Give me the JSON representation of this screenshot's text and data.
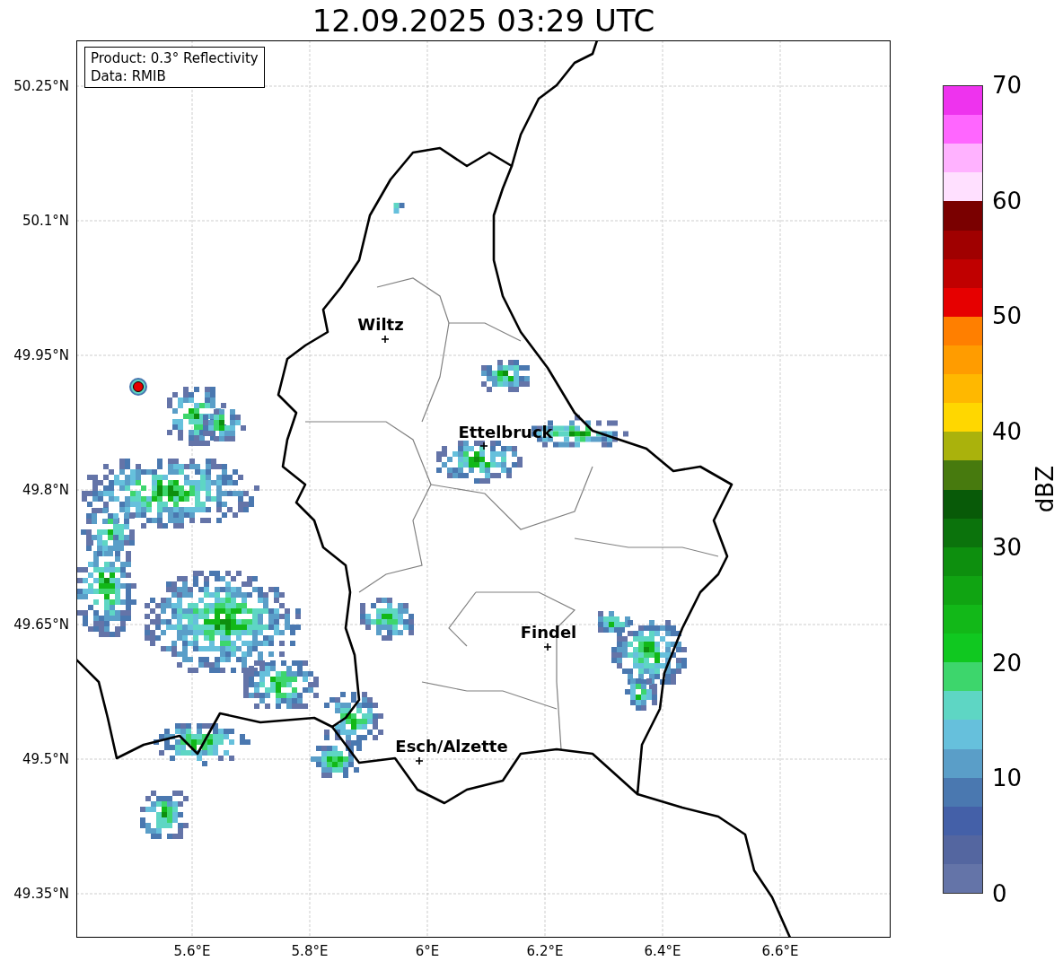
{
  "title": "12.09.2025 03:29 UTC",
  "info_box": [
    "Product: 0.3° Reflectivity",
    "Data: RMIB"
  ],
  "lat_labels": [
    "50.25°N",
    "50.1°N",
    "49.95°N",
    "49.8°N",
    "49.65°N",
    "49.5°N",
    "49.35°N"
  ],
  "lon_labels": [
    "5.6°E",
    "5.8°E",
    "6°E",
    "6.2°E",
    "6.4°E",
    "6.6°E"
  ],
  "cities": [
    {
      "label": "Wiltz"
    },
    {
      "label": "Ettelbruck"
    },
    {
      "label": "Findel"
    },
    {
      "label": "Esch/Alzette"
    }
  ],
  "colorbar": {
    "label": "dBZ",
    "ticks": [
      "70",
      "60",
      "50",
      "40",
      "30",
      "20",
      "10",
      "0"
    ],
    "bins": [
      {
        "color": "#ee33ee"
      },
      {
        "color": "#ff66ff"
      },
      {
        "color": "#ffb2ff"
      },
      {
        "color": "#ffe0ff"
      },
      {
        "color": "#7a0000"
      },
      {
        "color": "#a00000"
      },
      {
        "color": "#c00000"
      },
      {
        "color": "#e60000"
      },
      {
        "color": "#ff7f00"
      },
      {
        "color": "#ff9c00"
      },
      {
        "color": "#ffb800"
      },
      {
        "color": "#ffd700"
      },
      {
        "color": "#aab20c"
      },
      {
        "color": "#477a0e"
      },
      {
        "color": "#085a08"
      },
      {
        "color": "#0b730c"
      },
      {
        "color": "#0d8f0e"
      },
      {
        "color": "#10a412"
      },
      {
        "color": "#12b818"
      },
      {
        "color": "#10c820"
      },
      {
        "color": "#3dd66c"
      },
      {
        "color": "#5ed6c4"
      },
      {
        "color": "#66c0dc"
      },
      {
        "color": "#5a9ec8"
      },
      {
        "color": "#4a78b0"
      },
      {
        "color": "#4460a8"
      },
      {
        "color": "#5466a0"
      },
      {
        "color": "#6474a8"
      }
    ]
  }
}
